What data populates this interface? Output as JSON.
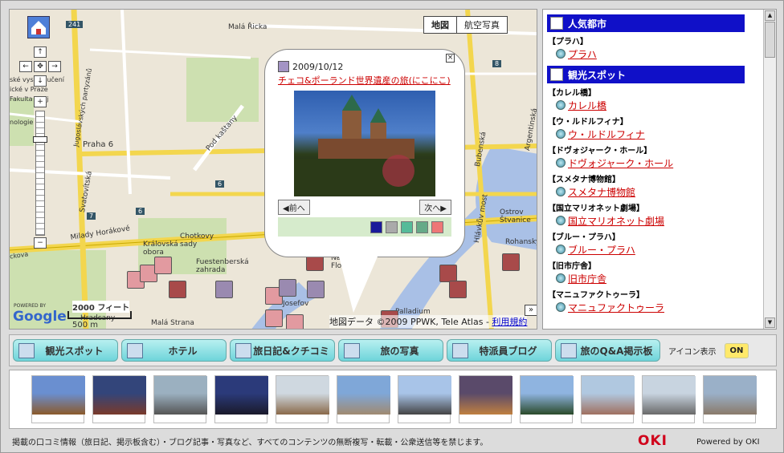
{
  "map": {
    "type_buttons": [
      "地図",
      "航空写真"
    ],
    "active_type": "地図",
    "labels": {
      "street_1": "Malá Řicka",
      "street_2": "Jugoslávských partyzánů",
      "street_3": "Praha 6",
      "street_4": "Svatovítská",
      "street_5": "Pod kaštany",
      "street_6": "Milady Horákové",
      "street_7": "Královská obora",
      "street_8": "Chotkovy sady",
      "street_9": "Fuestenberská zahrada",
      "street_10": "Josefov",
      "street_11": "Malá Strana",
      "street_12": "Bubenská",
      "street_13": "Argentinská",
      "street_14": "Ostrov Štvanice",
      "street_15": "Hlávkův most",
      "street_16": "Rohanský",
      "street_17": "Na Florenci",
      "street_18": "Palladium",
      "street_19": "Hradcany",
      "street_left_1": "ské vysoké učení",
      "street_left_2": "ické v Praze",
      "street_left_3": "Fakulta stroj",
      "street_left_4": "nologie",
      "street_left_5": "ckova",
      "road_241": "241",
      "road_6": "6",
      "road_7": "7",
      "road_6b": "6",
      "road_8": "8"
    },
    "scale_feet": "2000 フィート",
    "scale_m": "500 m",
    "powered_by": "POWERED BY",
    "google": "Google",
    "attribution": "地図データ ©2009 PPWK, Tele Atlas",
    "terms_link": "利用規約",
    "expand": "»"
  },
  "balloon": {
    "date": "2009/10/12",
    "title": "チェコ&ポーランド世界遺産の旅(にこにこ)",
    "prev": "◀前へ",
    "next": "次へ▶",
    "close": "×"
  },
  "sidebar": {
    "sections": [
      {
        "heading": "人気都市",
        "groups": [
          {
            "category": "【プラハ】",
            "item": "プラハ"
          }
        ]
      },
      {
        "heading": "観光スポット",
        "groups": [
          {
            "category": "【カレル橋】",
            "item": "カレル橋"
          },
          {
            "category": "【ウ・ルドルフィナ】",
            "item": "ウ・ルドルフィナ"
          },
          {
            "category": "【ドヴォジャーク・ホール】",
            "item": "ドヴォジャーク・ホール"
          },
          {
            "category": "【スメタナ博物館】",
            "item": "スメタナ博物館"
          },
          {
            "category": "【国立マリオネット劇場】",
            "item": "国立マリオネット劇場"
          },
          {
            "category": "【ブルー・プラハ】",
            "item": "ブルー・プラハ"
          },
          {
            "category": "【旧市庁舎】",
            "item": "旧市庁舎"
          },
          {
            "category": "【マニュファクトゥーラ】",
            "item": "マニュファクトゥーラ"
          }
        ]
      }
    ]
  },
  "buttons": [
    {
      "label": "観光スポット",
      "color": "#e2a0a8"
    },
    {
      "label": "ホテル",
      "color": "#a84a4a"
    },
    {
      "label": "旅日記&クチコミ",
      "color": "#9a8ab0"
    },
    {
      "label": "旅の写真",
      "color": "#7fc07f"
    },
    {
      "label": "特派員ブログ",
      "color": "#6fb06f"
    },
    {
      "label": "旅のQ&A掲示板",
      "color": "#e07070"
    }
  ],
  "icon_toggle": {
    "label": "アイコン表示",
    "state": "ON"
  },
  "thumbnails": 12,
  "footer": {
    "notice": "掲載の口コミ情報（旅日記、掲示板含む）・ブログ記事・写真など、すべてのコンテンツの無断複写・転載・公衆送信等を禁じます。",
    "logo": "OKI",
    "powered": "Powered by OKI"
  }
}
